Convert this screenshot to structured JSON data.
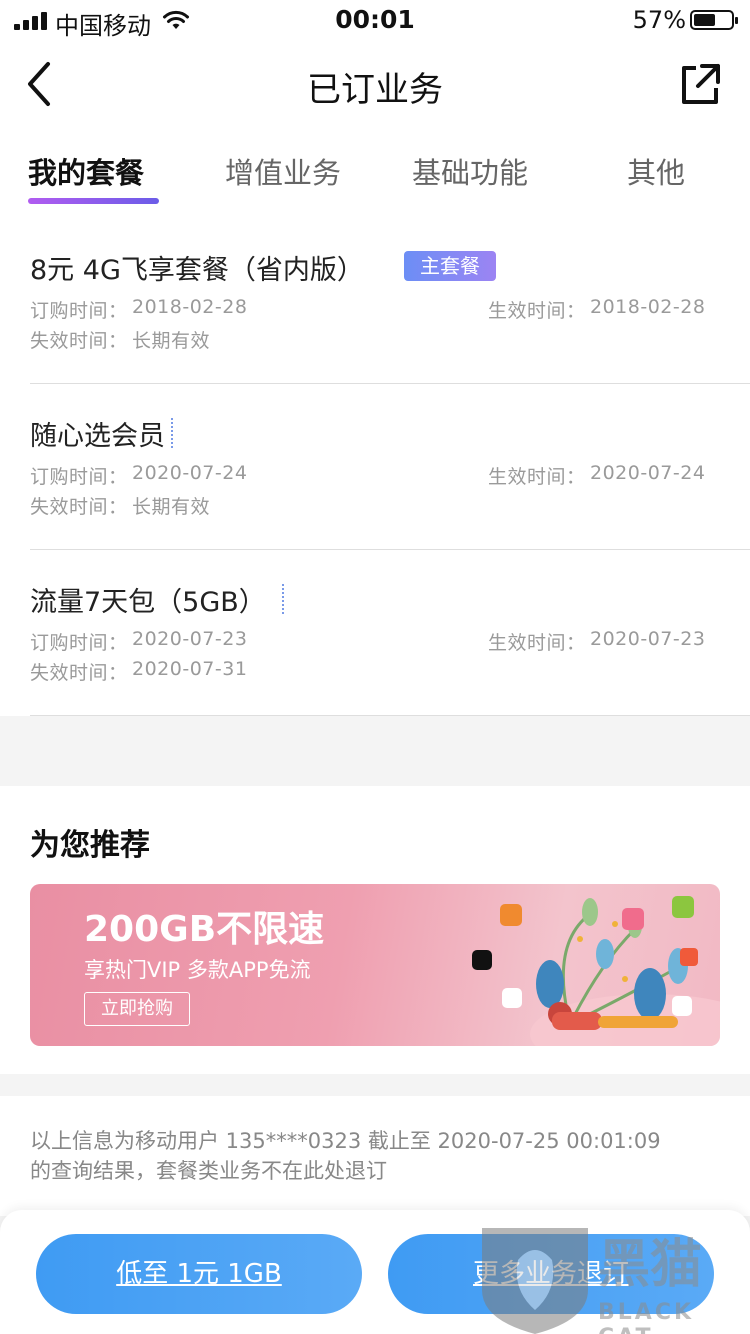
{
  "status_bar": {
    "carrier": "中国移动",
    "time": "00:01",
    "battery_pct": "57%",
    "battery_level": 0.57
  },
  "nav": {
    "title": "已订业务"
  },
  "tabs": [
    {
      "label": "我的套餐",
      "active": true
    },
    {
      "label": "增值业务",
      "active": false
    },
    {
      "label": "基础功能",
      "active": false
    },
    {
      "label": "其他",
      "active": false
    }
  ],
  "subscriptions": [
    {
      "name": "8元 4G飞享套餐（省内版）",
      "badge": "主套餐",
      "order_label": "订购时间：",
      "order_date": "2018-02-28",
      "effective_label": "生效时间：",
      "effective_date": "2018-02-28",
      "expire_label": "失效时间：",
      "expire_date": "长期有效"
    },
    {
      "name": "随心选会员",
      "order_label": "订购时间：",
      "order_date": "2020-07-24",
      "effective_label": "生效时间：",
      "effective_date": "2020-07-24",
      "expire_label": "失效时间：",
      "expire_date": "长期有效"
    },
    {
      "name": "流量7天包（5GB）",
      "order_label": "订购时间：",
      "order_date": "2020-07-23",
      "effective_label": "生效时间：",
      "effective_date": "2020-07-23",
      "expire_label": "失效时间：",
      "expire_date": "2020-07-31"
    }
  ],
  "recommend": {
    "title": "为您推荐",
    "banner": {
      "headline": "200GB不限速",
      "subline": "享热门VIP 多款APP免流",
      "button": "立即抢购"
    }
  },
  "note": "以上信息为移动用户 135****0323 截止至 2020-07-25 00:01:09 的查询结果，套餐类业务不在此处退订",
  "bottom": {
    "left_button": "低至 1元 1GB",
    "right_button": "更多业务退订"
  },
  "watermark": {
    "text": "黑猫",
    "sub": "BLACK CAT"
  }
}
